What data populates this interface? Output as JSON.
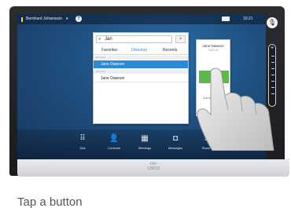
{
  "topbar": {
    "user": "Bernhard Johansson",
    "caret": "▾",
    "help": "?",
    "time": "10:21"
  },
  "directory": {
    "search_value": "Jan",
    "clear_label": ">",
    "tabs": [
      "Favorites",
      "Directory",
      "Recents"
    ],
    "active_tab": "Directory",
    "sections": [
      {
        "header": "Directory",
        "rows": [
          "Jane Dawson"
        ]
      },
      {
        "header": "Directory",
        "rows": [
          "Jane Dawson"
        ]
      }
    ]
  },
  "card": {
    "name": "Jane Dawson",
    "number": "7561125",
    "call_label": "Call",
    "favorite_label": "Add to Favorites"
  },
  "toolbar": {
    "items": [
      {
        "label": "Dial",
        "icon": "dialpad-icon"
      },
      {
        "label": "Contacts",
        "icon": "contacts-icon"
      },
      {
        "label": "Meetings",
        "icon": "calendar-icon"
      },
      {
        "label": "Messages",
        "icon": "voicemail-icon"
      },
      {
        "label": "Share",
        "icon": "share-icon"
      }
    ],
    "active": "Contacts"
  },
  "device": {
    "logo_line1": "·ılıılı·",
    "logo_line2": "CISCO"
  },
  "caption": "Tap a button",
  "colors": {
    "accent": "#2a8ad7",
    "call": "#5db74b",
    "status": "#f3d21a"
  }
}
